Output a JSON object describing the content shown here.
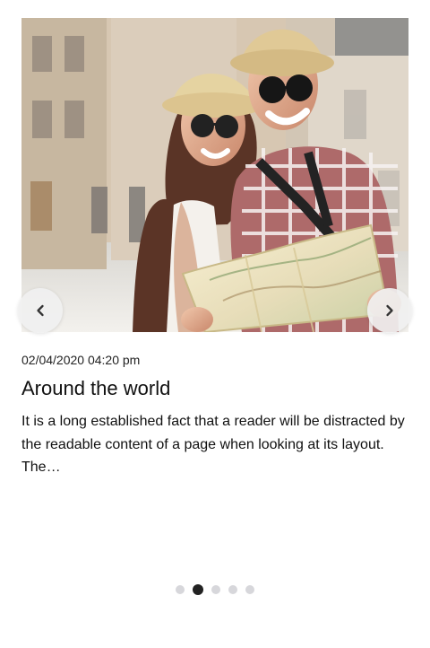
{
  "carousel": {
    "image_alt": "Smiling couple holding a map",
    "prev_icon": "chevron-left-icon",
    "next_icon": "chevron-right-icon",
    "active_index": 1,
    "dots_count": 5
  },
  "article": {
    "date": "02/04/2020 04:20 pm",
    "title": "Around the world",
    "excerpt": "It is a long established fact that a reader will be distracted by the readable content of a page when looking at its layout. The…"
  },
  "colors": {
    "dot_inactive": "#d7d7db",
    "dot_active": "#222222",
    "nav_background": "#f0f0f0"
  }
}
